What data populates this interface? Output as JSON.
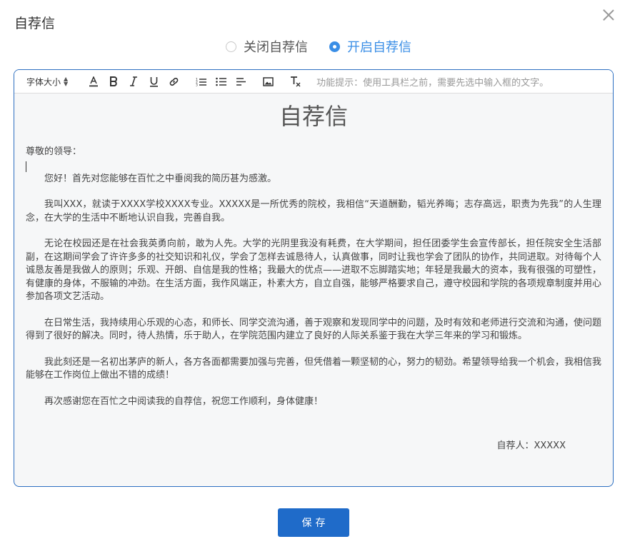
{
  "dialog": {
    "title": "自荐信"
  },
  "mode": {
    "options": [
      {
        "label": "关闭自荐信",
        "selected": false
      },
      {
        "label": "开启自荐信",
        "selected": true
      }
    ]
  },
  "toolbar": {
    "font_size_label": "字体大小",
    "icons": [
      "font-color-icon",
      "bold-icon",
      "italic-icon",
      "underline-icon",
      "link-icon",
      "ordered-list-icon",
      "unordered-list-icon",
      "align-left-icon",
      "image-icon",
      "clear-format-icon"
    ],
    "hint": "功能提示：使用工具栏之前，需要先选中输入框的文字。"
  },
  "letter": {
    "title": "自荐信",
    "greeting": "尊敬的领导：",
    "paragraphs": [
      "您好！首先对您能够在百忙之中垂阅我的简历甚为感激。",
      "我叫XXX，就读于XXXX学校XXXX专业。XXXXX是一所优秀的院校，我相信“天道酬勤，韬光养晦；志存高远，职责为先我”的人生理念，在大学的生活中不断地认识自我，完善自我。",
      "无论在校园还是在社会我英勇向前，敢为人先。大学的光阴里我没有耗费，在大学期间，担任团委学生会宣传部长，担任院安全生活部副，在这期间学会了许许多多的社交知识和礼仪，学会了怎样去诚恳待人，认真做事，同时让我也学会了团队的协作，共同进取。对待每个人诚恳友善是我做人的原则；乐观、开朗、自信是我的性格；我最大的优点——进取不忘脚踏实地；年轻是我最大的资本，我有很强的可塑性，有健康的身体，不服输的冲劲。在生活方面，我作风端正，朴素大方，自立自强，能够严格要求自己，遵守校园和学院的各项规章制度并用心参加各项文艺活动。",
      "在日常生活，我持续用心乐观的心态，和师长、同学交流沟通，善于观察和发现同学中的问题，及时有效和老师进行交流和沟通，使问题得到了很好的解决。同时，待人热情，乐于助人，在学院范围内建立了良好的人际关系鉴于我在大学三年来的学习和锻炼。",
      "我此刻还是一名初出茅庐的新人，各方各面都需要加强与完善，但凭借着一颗坚韧的心，努力的韧劲。希望领导给我一个机会，我相信我能够在工作岗位上做出不错的成绩！",
      "再次感谢您在百忙之中阅读我的自荐信，祝您工作顺利，身体健康！"
    ],
    "signature": "自荐人：XXXXX"
  },
  "footer": {
    "save_label": "保存"
  },
  "colors": {
    "accent": "#3a8ee6",
    "button": "#1f6bc9",
    "editor_border": "#2d6fc1"
  }
}
